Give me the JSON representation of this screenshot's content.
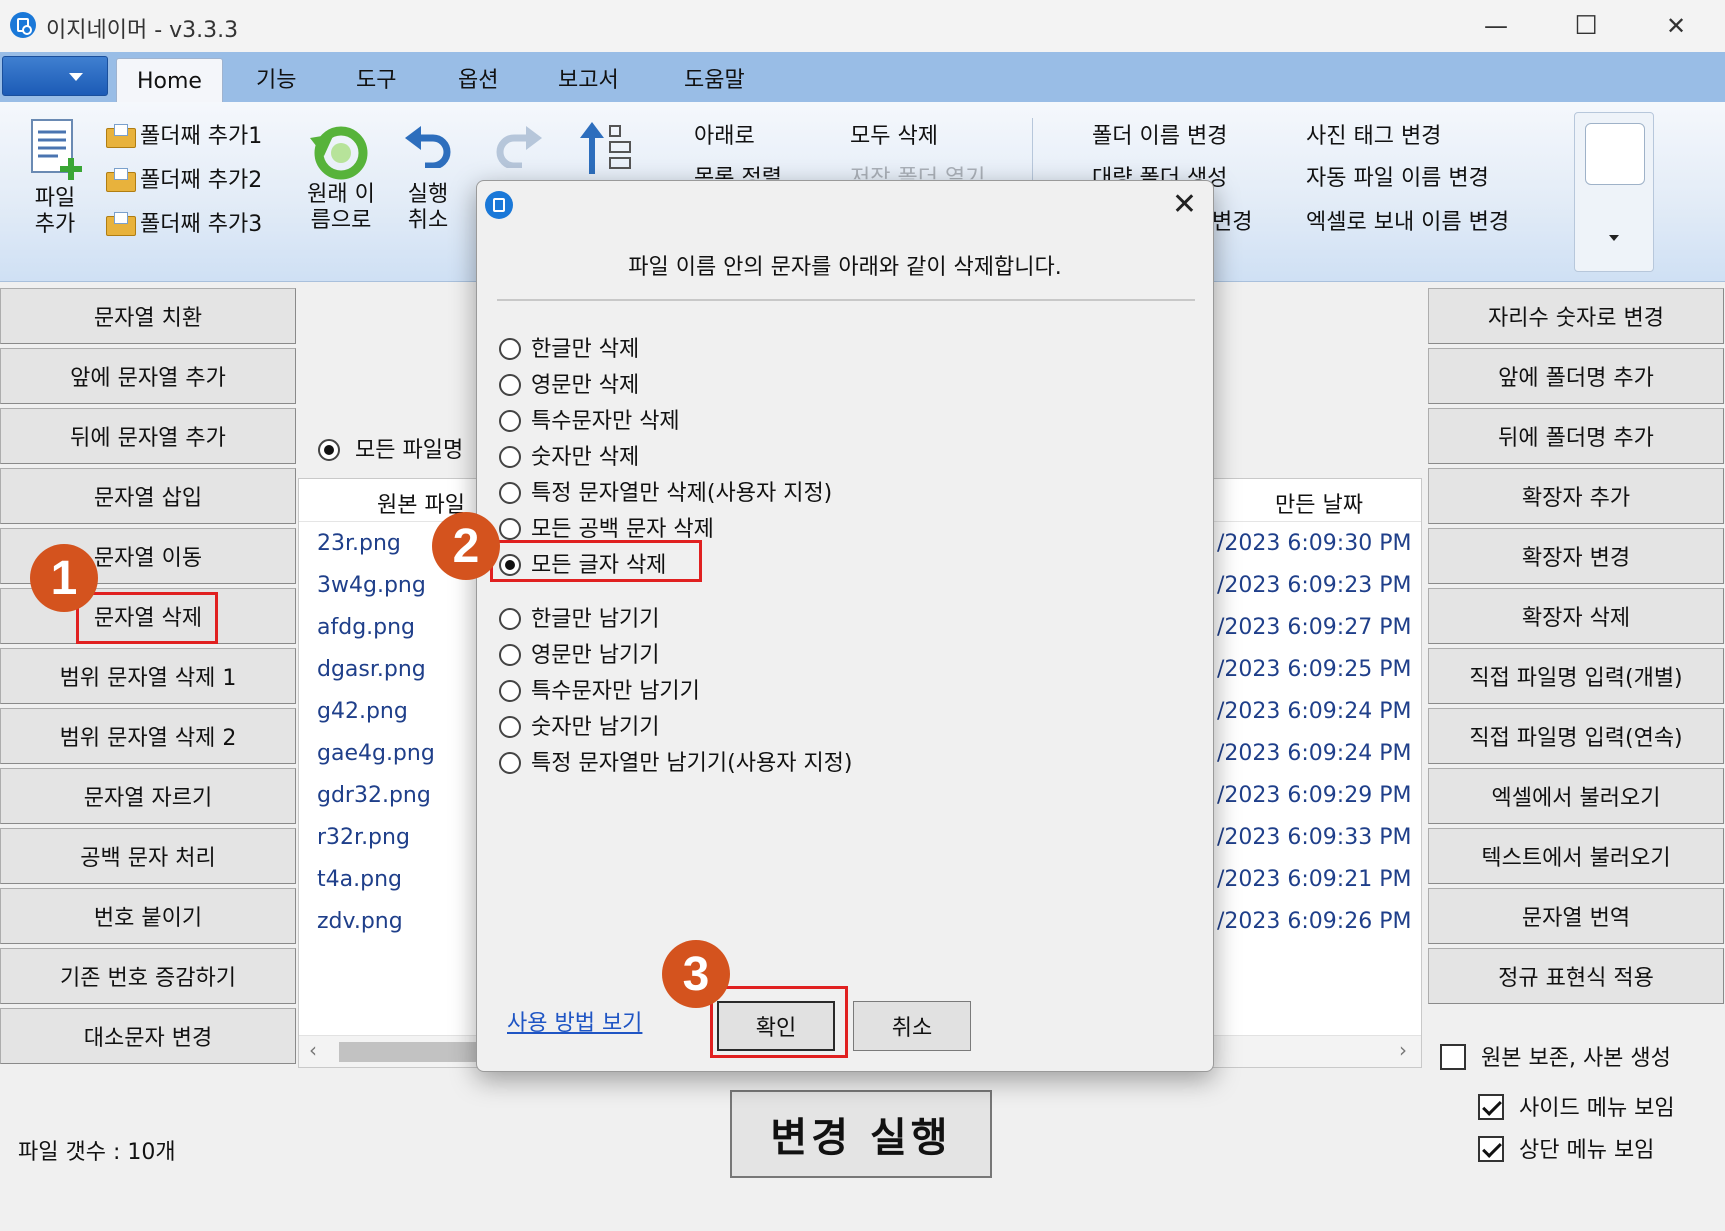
{
  "window": {
    "title": "이지네이머 - v3.3.3",
    "minimize": "—",
    "maximize": "☐",
    "close": "✕"
  },
  "tabs": [
    "Home",
    "기능",
    "도구",
    "옵션",
    "보고서",
    "도움말"
  ],
  "ribbon": {
    "add_file": "파일\n추가",
    "add_folder_1": "폴더째 추가1",
    "add_folder_2": "폴더째 추가2",
    "add_folder_3": "폴더째 추가3",
    "restore_original": "원래 이\n름으로",
    "undo": "실행\n취소",
    "move_down": "아래로",
    "sort_list": "목록 정렬",
    "delete_all": "모두 삭제",
    "open_saved_folder": "저장 폴더 열기",
    "rename_folder": "폴더 이름 변경",
    "bulk_folder_create": "대량 폴더 생성",
    "change_partial": "변경",
    "photo_tag_change": "사진 태그 변경",
    "auto_filename_change": "자동 파일 이름 변경",
    "excel_export_rename": "엑셀로 보내 이름 변경"
  },
  "left_buttons": [
    "문자열 치환",
    "앞에 문자열 추가",
    "뒤에 문자열 추가",
    "문자열 삽입",
    "문자열 이동",
    "문자열 삭제",
    "범위 문자열 삭제 1",
    "범위 문자열 삭제 2",
    "문자열 자르기",
    "공백 문자 처리",
    "번호 붙이기",
    "기존 번호 증감하기",
    "대소문자 변경"
  ],
  "right_buttons": [
    "자리수 숫자로 변경",
    "앞에 폴더명 추가",
    "뒤에 폴더명 추가",
    "확장자 추가",
    "확장자 변경",
    "확장자 삭제",
    "직접 파일명 입력(개별)",
    "직접 파일명 입력(연속)",
    "엑셀에서 불러오기",
    "텍스트에서 불러오기",
    "문자열 번역",
    "정규 표현식 적용"
  ],
  "scope_radio": "모든 파일명",
  "file_list": {
    "col_original": "원본 파일",
    "col_created": "만든 날짜",
    "files": [
      "23r.png",
      "3w4g.png",
      "afdg.png",
      "dgasr.png",
      "g42.png",
      "gae4g.png",
      "gdr32.png",
      "r32r.png",
      "t4a.png",
      "zdv.png"
    ],
    "dates": [
      "/2023 6:09:30 PM",
      "/2023 6:09:23 PM",
      "/2023 6:09:27 PM",
      "/2023 6:09:25 PM",
      "/2023 6:09:24 PM",
      "/2023 6:09:24 PM",
      "/2023 6:09:29 PM",
      "/2023 6:09:33 PM",
      "/2023 6:09:21 PM",
      "/2023 6:09:26 PM"
    ],
    "scroll_left": "‹",
    "scroll_right": "›"
  },
  "file_count": "파일 갯수 : 10개",
  "run_button": "변경 실행",
  "options": {
    "keep_original": "원본 보존, 사본 생성",
    "show_side_menu": "사이드 메뉴 보임",
    "show_top_menu": "상단 메뉴 보임"
  },
  "dialog": {
    "close": "✕",
    "heading": "파일 이름 안의 문자를 아래와 같이 삭제합니다.",
    "delete_options": [
      "한글만 삭제",
      "영문만 삭제",
      "특수문자만 삭제",
      "숫자만 삭제",
      "특정 문자열만 삭제(사용자 지정)",
      "모든 공백 문자 삭제",
      "모든 글자 삭제"
    ],
    "keep_options": [
      "한글만 남기기",
      "영문만 남기기",
      "특수문자만 남기기",
      "숫자만 남기기",
      "특정 문자열만 남기기(사용자 지정)"
    ],
    "selected": "모든 글자 삭제",
    "help_link": "사용 방법 보기",
    "ok": "확인",
    "cancel": "취소"
  },
  "badges": [
    "1",
    "2",
    "3"
  ],
  "colors": {
    "accent": "#1a78d8",
    "annotation": "#e02020",
    "badge": "#d4531e",
    "tabbar": "#99bde6"
  }
}
